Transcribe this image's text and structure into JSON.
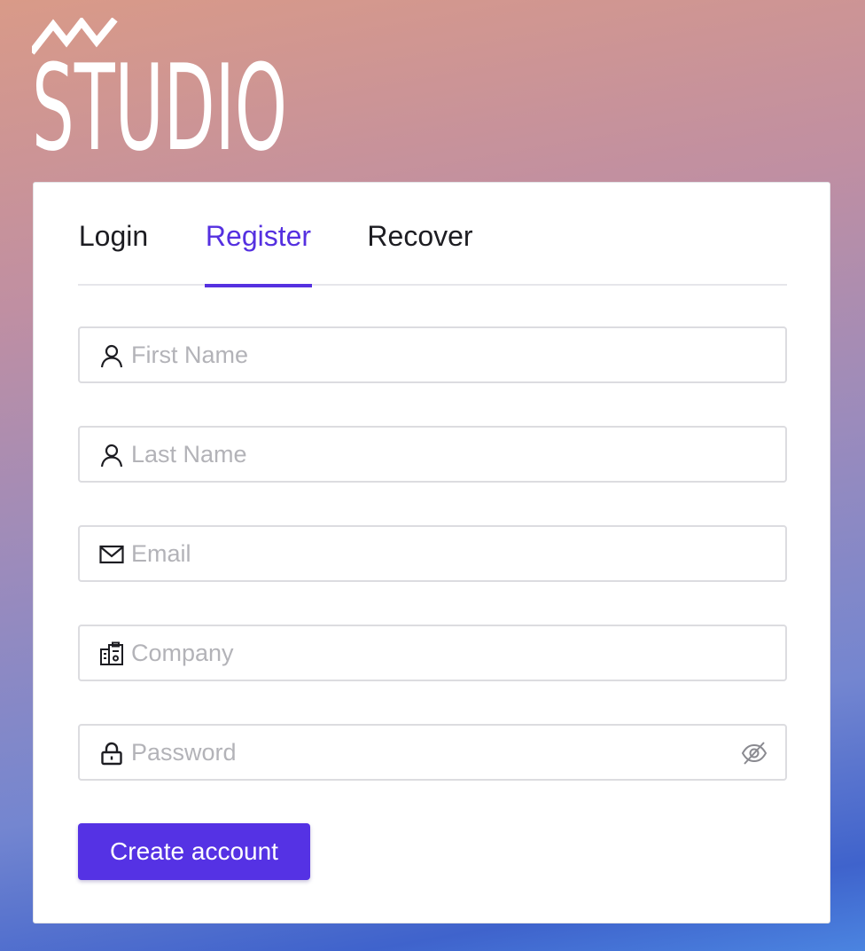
{
  "brand": {
    "name": "STUDIO"
  },
  "tabs": [
    {
      "label": "Login",
      "active": false
    },
    {
      "label": "Register",
      "active": true
    },
    {
      "label": "Recover",
      "active": false
    }
  ],
  "form": {
    "first_name": {
      "placeholder": "First Name",
      "value": "",
      "icon": "user-icon"
    },
    "last_name": {
      "placeholder": "Last Name",
      "value": "",
      "icon": "user-icon"
    },
    "email": {
      "placeholder": "Email",
      "value": "",
      "icon": "envelope-icon"
    },
    "company": {
      "placeholder": "Company",
      "value": "",
      "icon": "company-icon"
    },
    "password": {
      "placeholder": "Password",
      "value": "",
      "icon": "lock-icon",
      "toggle_icon": "eye-off-icon"
    },
    "submit_label": "Create account"
  },
  "colors": {
    "accent": "#5532e4",
    "tab_active": "#5530e0"
  }
}
